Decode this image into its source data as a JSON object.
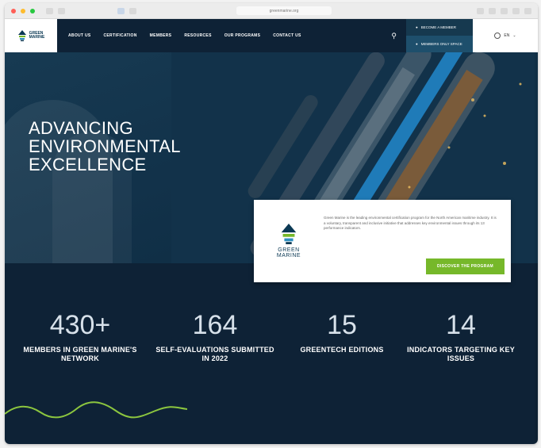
{
  "browser": {
    "url": "greenmarine.org"
  },
  "logo": {
    "line1": "GREEN",
    "line2": "MARINE"
  },
  "nav": {
    "items": [
      "ABOUT US",
      "CERTIFICATION",
      "MEMBERS",
      "RESOURCES",
      "OUR PROGRAMS",
      "CONTACT US"
    ]
  },
  "cta": {
    "primary": "BECOME A MEMBER",
    "secondary": "MEMBERS ONLY SPACE"
  },
  "lang": {
    "label": "EN"
  },
  "hero": {
    "title_line1": "ADVANCING",
    "title_line2": "ENVIRONMENTAL",
    "title_line3": "EXCELLENCE"
  },
  "card": {
    "logo_line1": "GREEN",
    "logo_line2": "MARINE",
    "text": "Green Marine is the leading environmental certification program for the North American maritime industry. It is a voluntary, transparent and inclusive initiative that addresses key environmental issues through its 13 performance indicators.",
    "cta_label": "DISCOVER THE PROGRAM"
  },
  "stats": [
    {
      "number": "430+",
      "label": "MEMBERS IN GREEN MARINE'S NETWORK"
    },
    {
      "number": "164",
      "label": "SELF-EVALUATIONS SUBMITTED IN 2022"
    },
    {
      "number": "15",
      "label": "GREENTECH EDITIONS"
    },
    {
      "number": "14",
      "label": "INDICATORS TARGETING KEY ISSUES"
    }
  ],
  "colors": {
    "navy": "#0e2236",
    "accent_green": "#76b82a",
    "brand_teal": "#0b3954"
  }
}
